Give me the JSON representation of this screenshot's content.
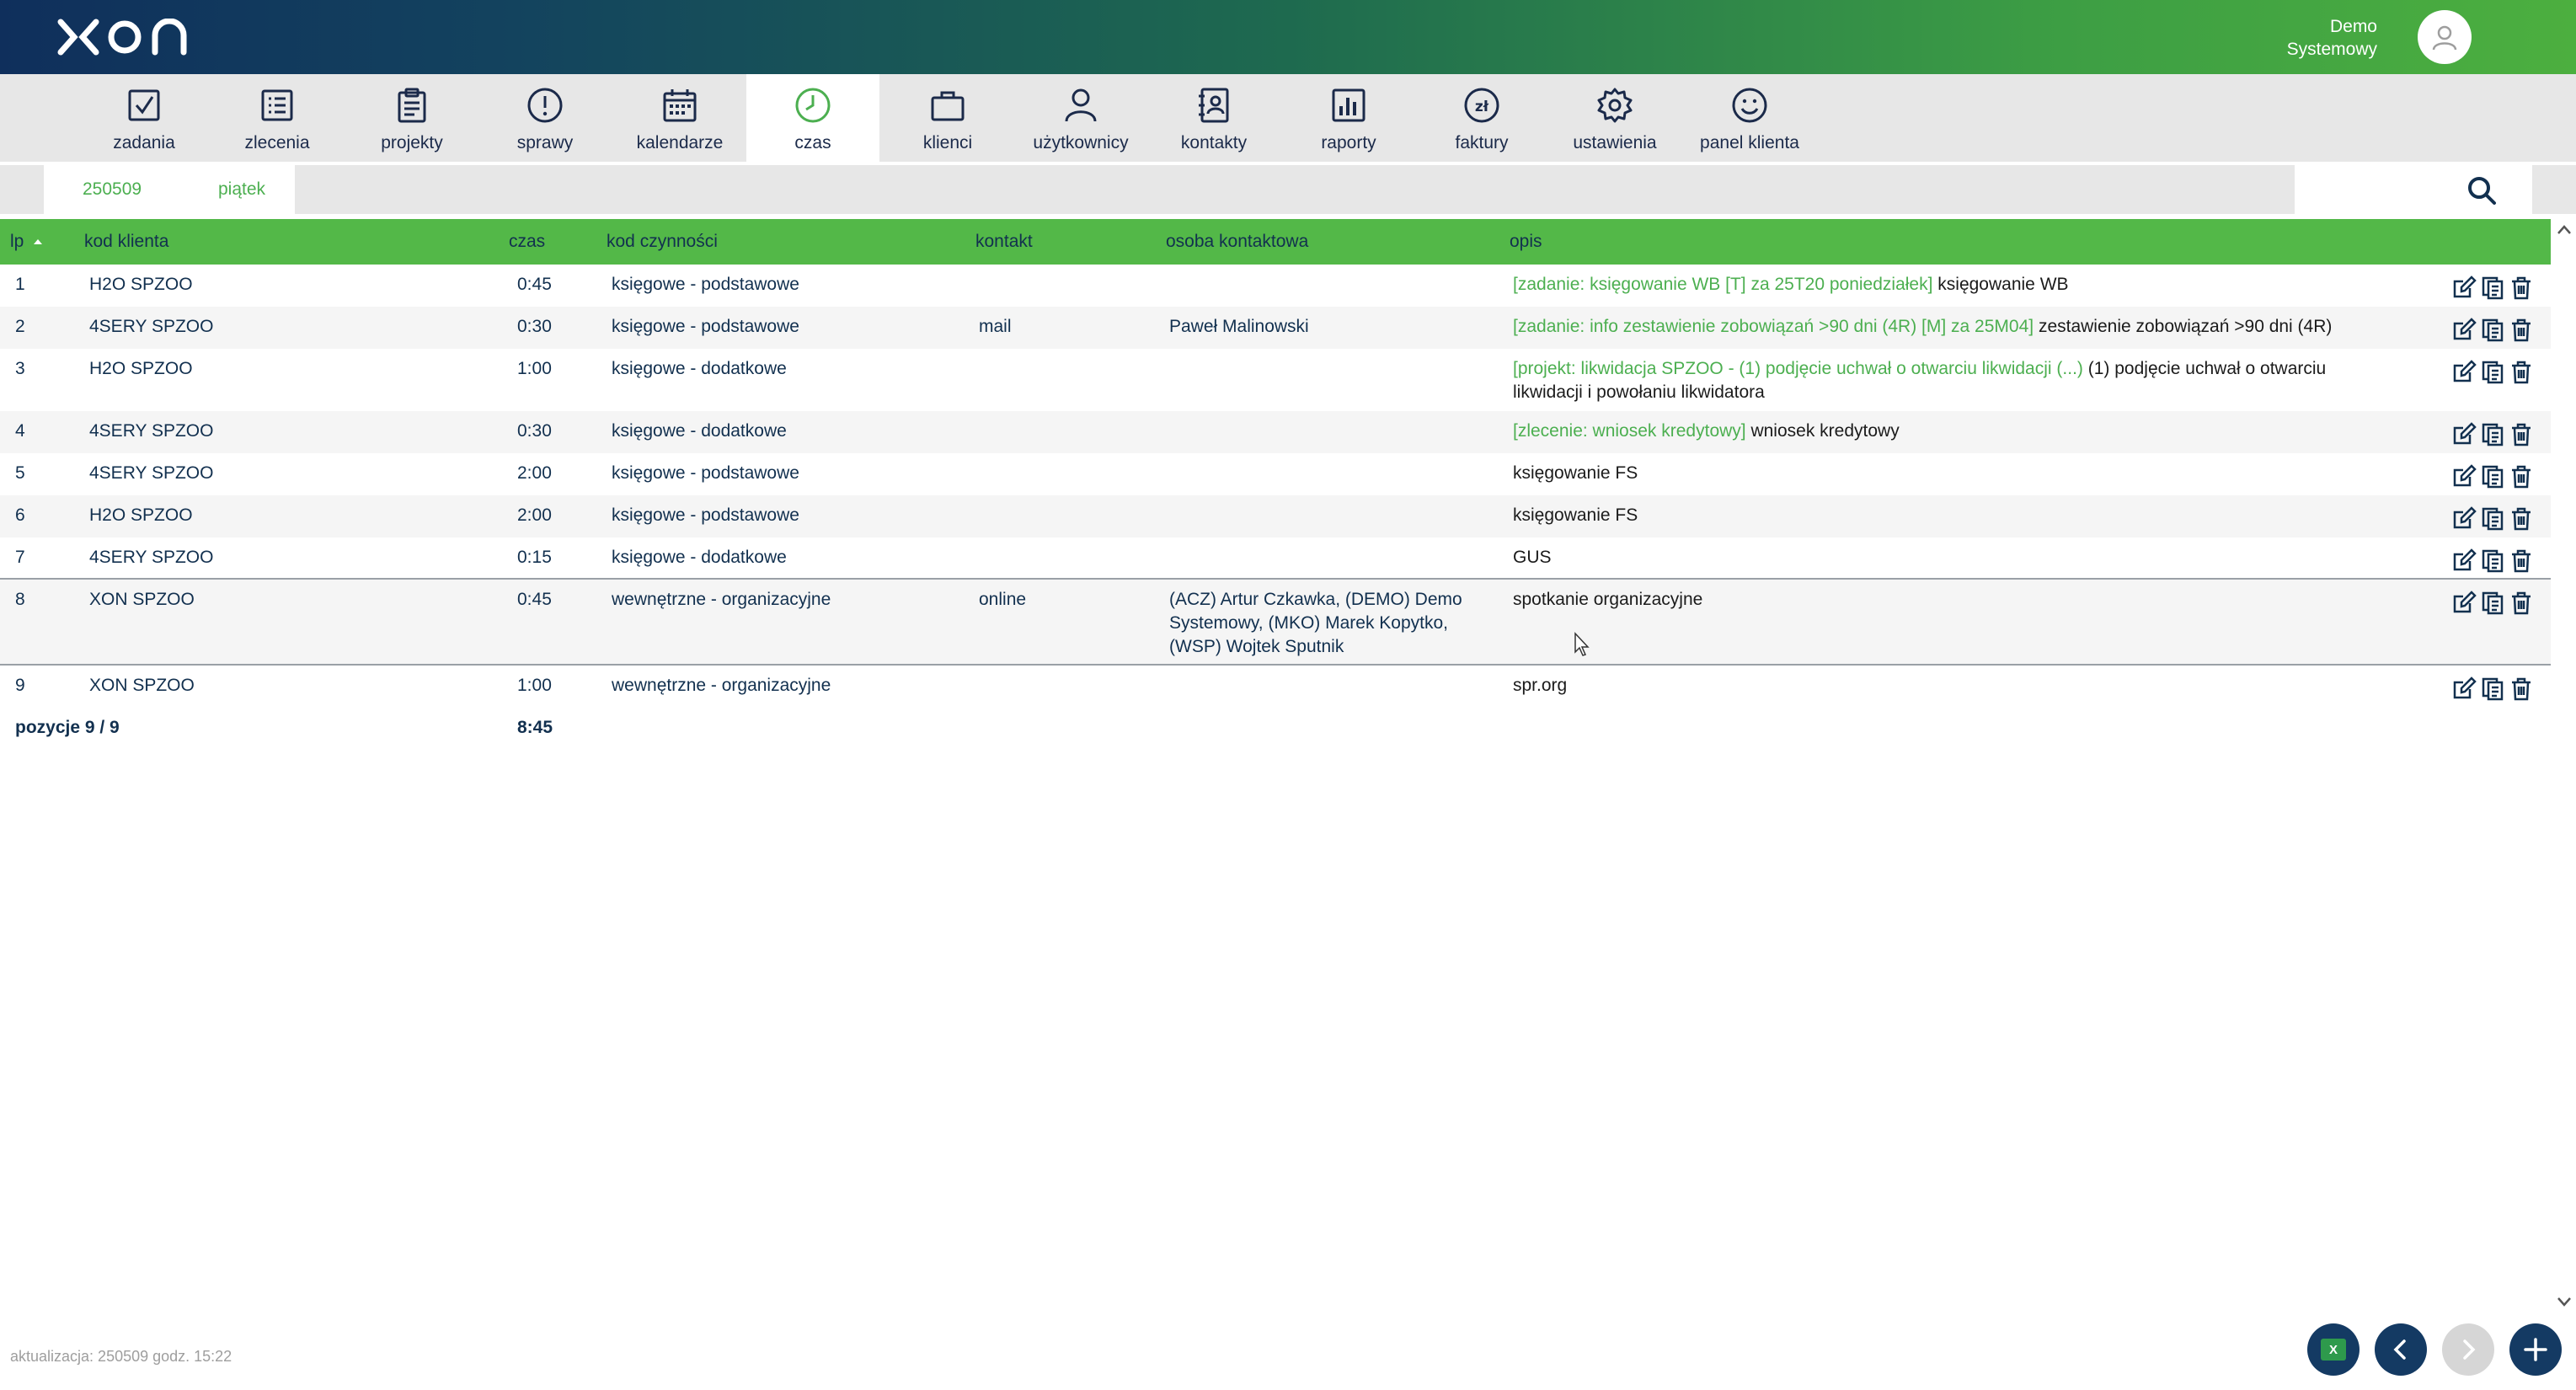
{
  "header": {
    "logo_icon": "xon-logo",
    "user_name_line1": "Demo",
    "user_name_line2": "Systemowy",
    "avatar_icon": "user-icon"
  },
  "nav": {
    "items": [
      {
        "label": "zadania",
        "icon": "checkbox-icon"
      },
      {
        "label": "zlecenia",
        "icon": "list-icon"
      },
      {
        "label": "projekty",
        "icon": "clipboard-icon"
      },
      {
        "label": "sprawy",
        "icon": "exclamation-icon"
      },
      {
        "label": "kalendarze",
        "icon": "calendar-icon"
      },
      {
        "label": "czas",
        "icon": "clock-icon",
        "active": true
      },
      {
        "label": "klienci",
        "icon": "briefcase-icon"
      },
      {
        "label": "użytkownicy",
        "icon": "person-icon"
      },
      {
        "label": "kontakty",
        "icon": "contact-book-icon"
      },
      {
        "label": "raporty",
        "icon": "bar-chart-icon"
      },
      {
        "label": "faktury",
        "icon": "zloty-icon"
      },
      {
        "label": "ustawienia",
        "icon": "gear-icon"
      },
      {
        "label": "panel klienta",
        "icon": "smiley-icon"
      }
    ]
  },
  "filter": {
    "date": "250509",
    "day": "piątek",
    "search_icon": "search-icon"
  },
  "table": {
    "columns": {
      "lp": "lp",
      "kod_klienta": "kod klienta",
      "czas": "czas",
      "kod_czynnosci": "kod czynności",
      "kontakt": "kontakt",
      "osoba_kontaktowa": "osoba kontaktowa",
      "opis": "opis"
    },
    "sort_icon": "sort-asc-icon",
    "rows": [
      {
        "lp": "1",
        "client": "H2O SPZOO",
        "time": "0:45",
        "activity": "księgowe - podstawowe",
        "contact": "",
        "person": "",
        "desc_tag": "[zadanie: księgowanie WB [T] za 25T20 poniedziałek]",
        "desc": " księgowanie WB"
      },
      {
        "lp": "2",
        "client": "4SERY SPZOO",
        "time": "0:30",
        "activity": "księgowe - podstawowe",
        "contact": "mail",
        "person": "Paweł Malinowski",
        "desc_tag": "[zadanie: info zestawienie zobowiązań >90 dni (4R) [M] za 25M04]",
        "desc": " zestawienie zobowiązań >90 dni (4R)"
      },
      {
        "lp": "3",
        "client": "H2O SPZOO",
        "time": "1:00",
        "activity": "księgowe - dodatkowe",
        "contact": "",
        "person": "",
        "desc_tag": "[projekt: likwidacja SPZOO - (1) podjęcie uchwał o otwarciu likwidacji (...)",
        "desc": " (1) podjęcie uchwał o otwarciu likwidacji i powołaniu likwidatora"
      },
      {
        "lp": "4",
        "client": "4SERY SPZOO",
        "time": "0:30",
        "activity": "księgowe - dodatkowe",
        "contact": "",
        "person": "",
        "desc_tag": "[zlecenie: wniosek kredytowy]",
        "desc": " wniosek kredytowy"
      },
      {
        "lp": "5",
        "client": "4SERY SPZOO",
        "time": "2:00",
        "activity": "księgowe - podstawowe",
        "contact": "",
        "person": "",
        "desc_tag": "",
        "desc": "księgowanie FS"
      },
      {
        "lp": "6",
        "client": "H2O SPZOO",
        "time": "2:00",
        "activity": "księgowe - podstawowe",
        "contact": "",
        "person": "",
        "desc_tag": "",
        "desc": "księgowanie FS"
      },
      {
        "lp": "7",
        "client": "4SERY SPZOO",
        "time": "0:15",
        "activity": "księgowe - dodatkowe",
        "contact": "",
        "person": "",
        "desc_tag": "",
        "desc": "GUS"
      },
      {
        "lp": "8",
        "client": "XON SPZOO",
        "time": "0:45",
        "activity": "wewnętrzne - organizacyjne",
        "contact": "online",
        "person": "(ACZ) Artur Czkawka, (DEMO) Demo Systemowy, (MKO) Marek Kopytko, (WSP) Wojtek Sputnik",
        "desc_tag": "",
        "desc": "spotkanie organizacyjne"
      },
      {
        "lp": "9",
        "client": "XON SPZOO",
        "time": "1:00",
        "activity": "wewnętrzne - organizacyjne",
        "contact": "",
        "person": "",
        "desc_tag": "",
        "desc": "spr.org"
      }
    ],
    "row_action_icons": [
      "edit-icon",
      "copy-icon",
      "trash-icon"
    ]
  },
  "summary": {
    "label": "pozycje 9 / 9",
    "total": "8:45"
  },
  "footer": {
    "update_text": "aktualizacja: 250509 godz. 15:22",
    "excel_label": "X",
    "buttons": [
      "excel-export-icon",
      "chevron-left-icon",
      "chevron-right-icon",
      "plus-icon"
    ]
  },
  "colors": {
    "brand_green": "#53b848",
    "brand_navy": "#143a63",
    "tag_green": "#4caf50"
  }
}
